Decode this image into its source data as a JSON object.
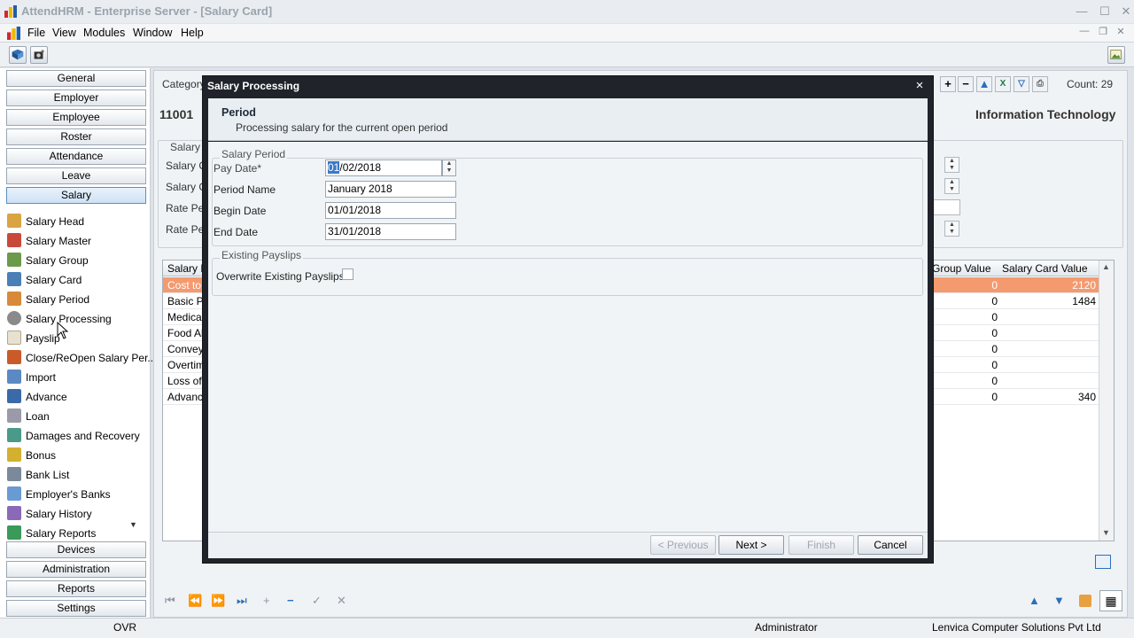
{
  "window": {
    "title": "AttendHRM - Enterprise Server - [Salary Card]"
  },
  "menu": [
    "File",
    "View",
    "Modules",
    "Window",
    "Help"
  ],
  "sidebar": {
    "top_buttons": [
      "General",
      "Employer",
      "Employee",
      "Roster",
      "Attendance",
      "Leave",
      "Salary"
    ],
    "active_button": "Salary",
    "items": [
      "Salary Head",
      "Salary Master",
      "Salary Group",
      "Salary Card",
      "Salary Period",
      "Salary Processing",
      "Payslip",
      "Close/ReOpen Salary Per...",
      "Import",
      "Advance",
      "Loan",
      "Damages and Recovery",
      "Bonus",
      "Bank List",
      "Employer's Banks",
      "Salary History",
      "Salary Reports"
    ],
    "bottom_buttons": [
      "Devices",
      "Administration",
      "Reports",
      "Settings"
    ]
  },
  "main": {
    "category_label": "Category",
    "employee_code": "11001",
    "department": "Information Technology",
    "count": "Count: 29",
    "salary_group_label": "Salary",
    "fields": [
      "Salary C",
      "Salary G",
      "Rate Pe",
      "Rate Pe"
    ],
    "grid": {
      "headers": [
        "Salary H",
        "Group Value",
        "Salary Card Value"
      ],
      "rows": [
        {
          "name": "Cost to",
          "group": "0",
          "card": "2120"
        },
        {
          "name": "Basic P",
          "group": "0",
          "card": "1484"
        },
        {
          "name": "Medical",
          "group": "0",
          "card": ""
        },
        {
          "name": "Food All",
          "group": "0",
          "card": ""
        },
        {
          "name": "Convey",
          "group": "0",
          "card": ""
        },
        {
          "name": "Overtim",
          "group": "0",
          "card": ""
        },
        {
          "name": "Loss of",
          "group": "0",
          "card": ""
        },
        {
          "name": "Advanc",
          "group": "0",
          "card": "340"
        }
      ]
    }
  },
  "dialog": {
    "title": "Salary Processing",
    "close": "×",
    "header_title": "Period",
    "header_sub": "Processing salary for the current open period",
    "salary_period_group": "Salary Period",
    "pay_date_label": "Pay Date*",
    "pay_date_day": "01",
    "pay_date_rest": "/02/2018",
    "period_name_label": "Period Name",
    "period_name": "January 2018",
    "begin_date_label": "Begin Date",
    "begin_date": "01/01/2018",
    "end_date_label": "End Date",
    "end_date": "31/01/2018",
    "existing_group": "Existing Payslips",
    "overwrite_label": "Overwrite Existing Payslips",
    "buttons": {
      "previous": "< Previous",
      "next": "Next >",
      "finish": "Finish",
      "cancel": "Cancel"
    }
  },
  "status": {
    "mode": "OVR",
    "user": "Administrator",
    "company": "Lenvica Computer Solutions Pvt Ltd"
  }
}
